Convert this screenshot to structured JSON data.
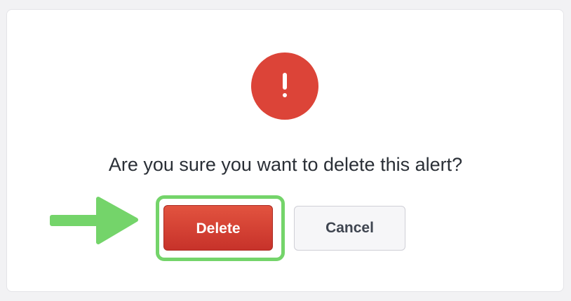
{
  "dialog": {
    "icon": "exclamation-icon",
    "message": "Are you sure you want to delete this alert?",
    "delete_label": "Delete",
    "cancel_label": "Cancel"
  },
  "annotation": {
    "arrow_icon": "arrow-right-icon",
    "highlight_target": "Delete"
  },
  "colors": {
    "alert_red": "#dc4438",
    "delete_red": "#d1392f",
    "highlight_green": "#74d46a"
  }
}
